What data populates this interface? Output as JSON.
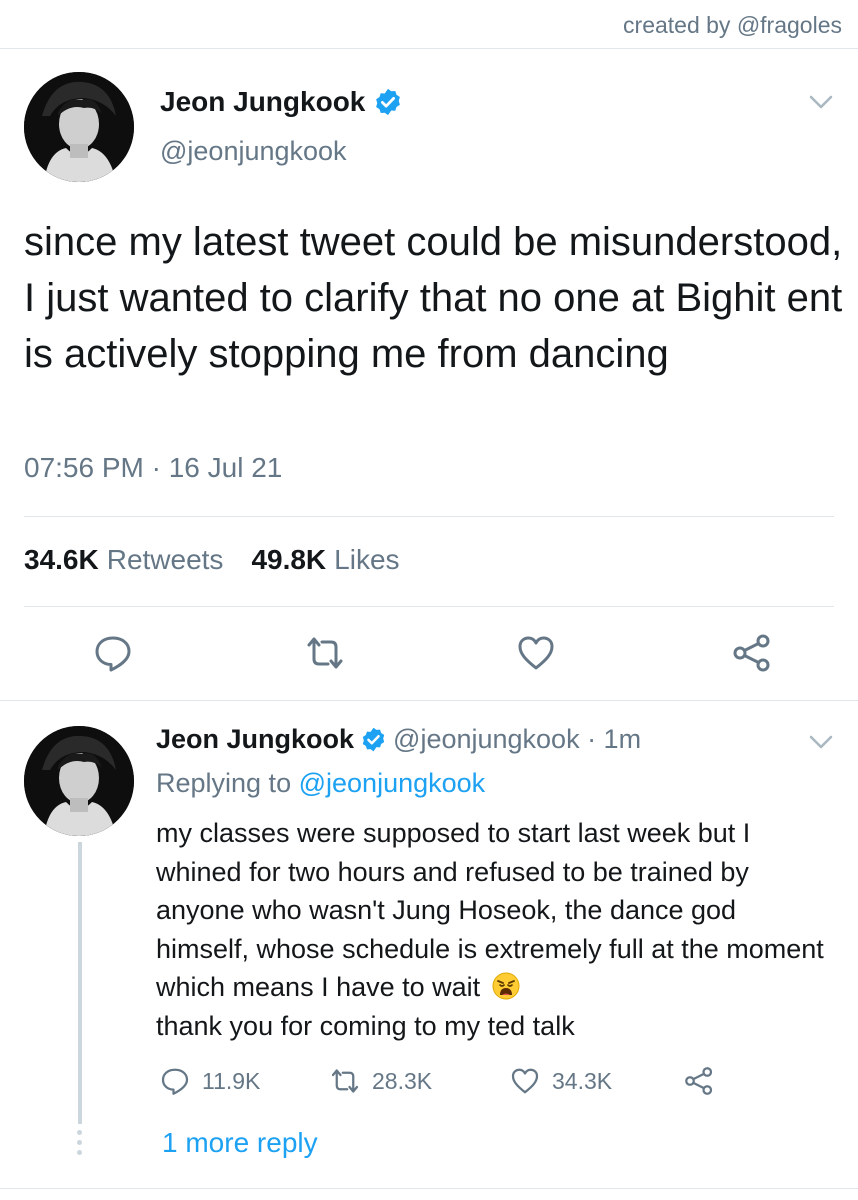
{
  "credit": "created by @fragoles",
  "main_tweet": {
    "name": "Jeon Jungkook",
    "handle": "@jeonjungkook",
    "text": "since my latest tweet could be misunderstood, I just wanted to clarify that no one at Bighit ent is actively stopping me from dancing",
    "timestamp": "07:56 PM · 16 Jul 21",
    "retweets_count": "34.6K",
    "retweets_label": "Retweets",
    "likes_count": "49.8K",
    "likes_label": "Likes",
    "actions": [
      "reply-icon",
      "retweet-icon",
      "like-icon",
      "share-icon"
    ]
  },
  "reply_tweet": {
    "name": "Jeon Jungkook",
    "handle_time": "@jeonjungkook · 1m",
    "replying_prefix": "Replying to",
    "replying_to": "@jeonjungkook",
    "text": "my classes were supposed to start last week but I whined for two hours and refused to be trained by anyone who wasn't Jung Hoseok, the dance god himself, whose schedule is extremely full at the moment which means I have to wait",
    "text_after_emoji": "thank you for coming to my ted talk",
    "emoji": "weary-face-emoji",
    "reply_count": "11.9K",
    "retweet_count": "28.3K",
    "like_count": "34.3K"
  },
  "more_reply": "1 more reply",
  "colors": {
    "accent": "#1da1f2",
    "secondary_text": "#657786",
    "divider": "#e1e8ed"
  }
}
